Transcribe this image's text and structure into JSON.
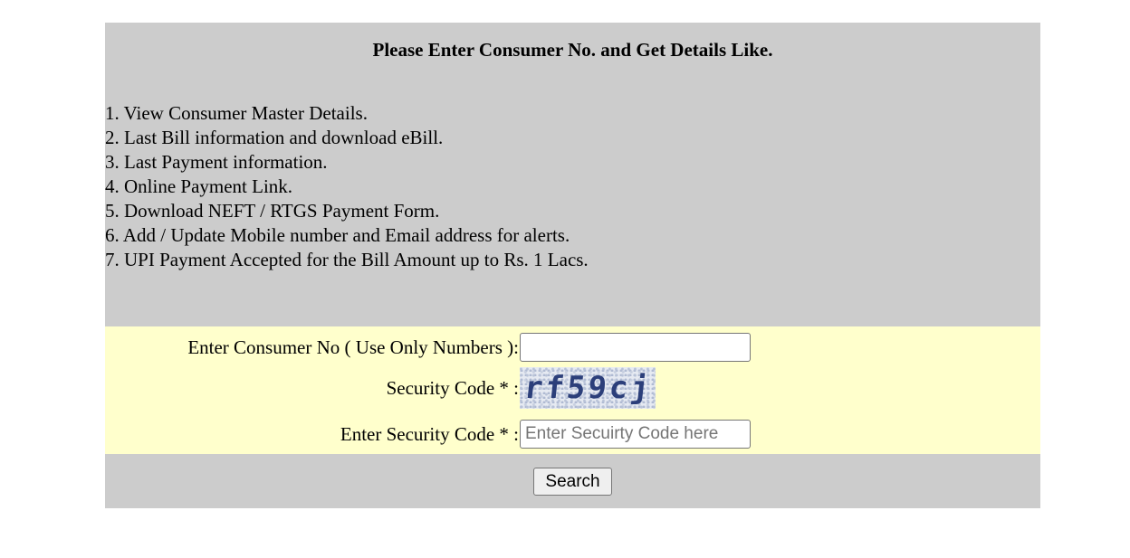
{
  "heading": "Please Enter Consumer No. and Get Details Like.",
  "features": [
    "1. View Consumer Master Details.",
    "2. Last Bill information and download eBill.",
    "3. Last Payment information.",
    "4. Online Payment Link.",
    "5. Download NEFT / RTGS Payment Form.",
    "6. Add / Update Mobile number and Email address for alerts.",
    "7. UPI Payment Accepted for the Bill Amount up to Rs. 1 Lacs."
  ],
  "form": {
    "consumer_label": "Enter Consumer No ( Use Only Numbers ):",
    "consumer_value": "",
    "security_label": "Security Code * :",
    "captcha_text": "rf59cj",
    "enter_security_label": "Enter Security Code * :",
    "security_placeholder": "Enter Secuirty Code here",
    "search_label": "Search"
  },
  "colors": {
    "info_bg": "#cccccc",
    "form_bg": "#ffffcc",
    "captcha_text": "#2c3f7a"
  }
}
